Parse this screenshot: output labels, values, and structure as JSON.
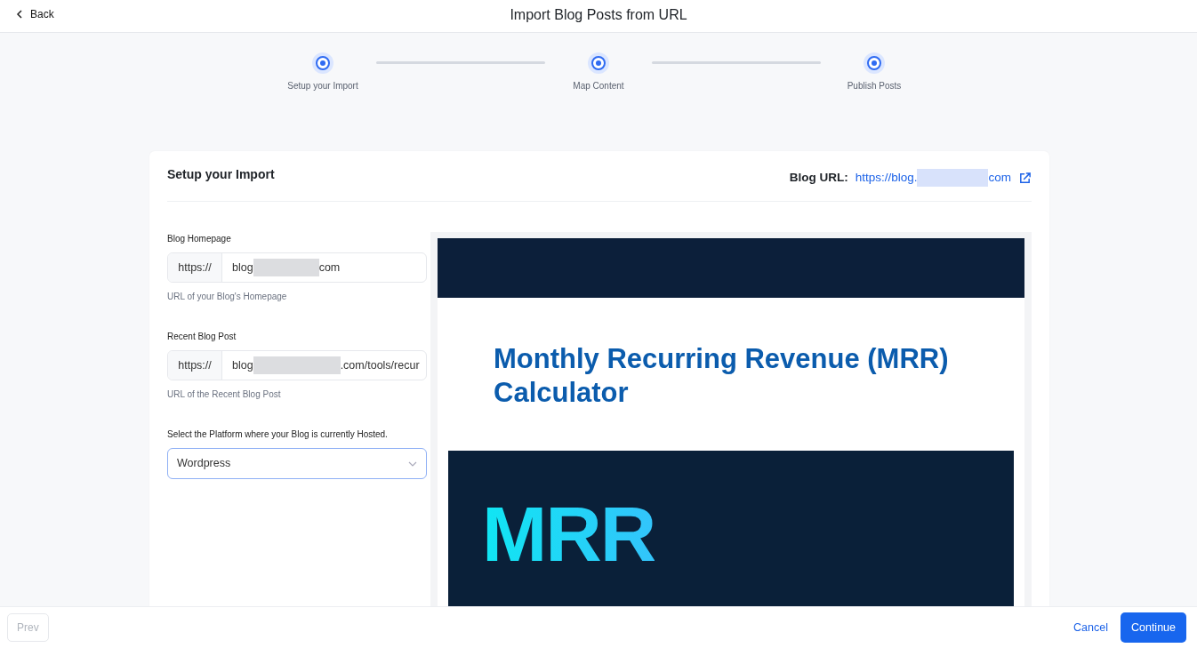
{
  "header": {
    "back": "Back",
    "title": "Import Blog Posts from URL"
  },
  "steps": [
    {
      "label": "Setup your Import"
    },
    {
      "label": "Map Content"
    },
    {
      "label": "Publish Posts"
    }
  ],
  "card": {
    "title": "Setup your Import",
    "blog_url_label": "Blog URL:",
    "blog_url_start": "https://blog.",
    "blog_url_end": "com"
  },
  "fields": [
    {
      "label": "Blog Homepage",
      "prefix": "https://",
      "value_start": "blog",
      "value_end": "com",
      "help": "URL of your Blog's Homepage"
    },
    {
      "label": "Recent Blog Post",
      "prefix": "https://",
      "value_start": "blog",
      "value_end": ".com/tools/recur",
      "help": "URL of the Recent Blog Post"
    }
  ],
  "platform": {
    "label": "Select the Platform where your Blog is currently Hosted.",
    "value": "Wordpress"
  },
  "preview": {
    "heading": "Monthly Recurring Revenue (MRR) Calculator",
    "banner_text": "MRR"
  },
  "footer": {
    "prev": "Prev",
    "prev_disabled": true,
    "cancel": "Cancel",
    "continue": "Continue"
  }
}
